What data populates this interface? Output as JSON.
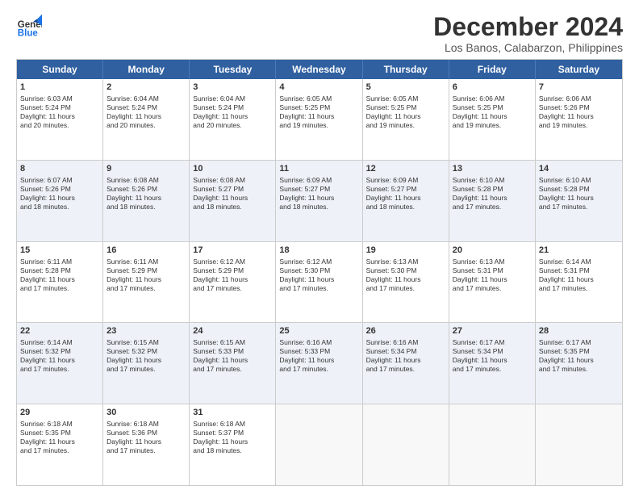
{
  "logo": {
    "text_general": "General",
    "text_blue": "Blue"
  },
  "title": "December 2024",
  "subtitle": "Los Banos, Calabarzon, Philippines",
  "days_of_week": [
    "Sunday",
    "Monday",
    "Tuesday",
    "Wednesday",
    "Thursday",
    "Friday",
    "Saturday"
  ],
  "weeks": [
    [
      {
        "day": "1",
        "text": "Sunrise: 6:03 AM\nSunset: 5:24 PM\nDaylight: 11 hours\nand 20 minutes."
      },
      {
        "day": "2",
        "text": "Sunrise: 6:04 AM\nSunset: 5:24 PM\nDaylight: 11 hours\nand 20 minutes."
      },
      {
        "day": "3",
        "text": "Sunrise: 6:04 AM\nSunset: 5:24 PM\nDaylight: 11 hours\nand 20 minutes."
      },
      {
        "day": "4",
        "text": "Sunrise: 6:05 AM\nSunset: 5:25 PM\nDaylight: 11 hours\nand 19 minutes."
      },
      {
        "day": "5",
        "text": "Sunrise: 6:05 AM\nSunset: 5:25 PM\nDaylight: 11 hours\nand 19 minutes."
      },
      {
        "day": "6",
        "text": "Sunrise: 6:06 AM\nSunset: 5:25 PM\nDaylight: 11 hours\nand 19 minutes."
      },
      {
        "day": "7",
        "text": "Sunrise: 6:06 AM\nSunset: 5:26 PM\nDaylight: 11 hours\nand 19 minutes."
      }
    ],
    [
      {
        "day": "8",
        "text": "Sunrise: 6:07 AM\nSunset: 5:26 PM\nDaylight: 11 hours\nand 18 minutes."
      },
      {
        "day": "9",
        "text": "Sunrise: 6:08 AM\nSunset: 5:26 PM\nDaylight: 11 hours\nand 18 minutes."
      },
      {
        "day": "10",
        "text": "Sunrise: 6:08 AM\nSunset: 5:27 PM\nDaylight: 11 hours\nand 18 minutes."
      },
      {
        "day": "11",
        "text": "Sunrise: 6:09 AM\nSunset: 5:27 PM\nDaylight: 11 hours\nand 18 minutes."
      },
      {
        "day": "12",
        "text": "Sunrise: 6:09 AM\nSunset: 5:27 PM\nDaylight: 11 hours\nand 18 minutes."
      },
      {
        "day": "13",
        "text": "Sunrise: 6:10 AM\nSunset: 5:28 PM\nDaylight: 11 hours\nand 17 minutes."
      },
      {
        "day": "14",
        "text": "Sunrise: 6:10 AM\nSunset: 5:28 PM\nDaylight: 11 hours\nand 17 minutes."
      }
    ],
    [
      {
        "day": "15",
        "text": "Sunrise: 6:11 AM\nSunset: 5:28 PM\nDaylight: 11 hours\nand 17 minutes."
      },
      {
        "day": "16",
        "text": "Sunrise: 6:11 AM\nSunset: 5:29 PM\nDaylight: 11 hours\nand 17 minutes."
      },
      {
        "day": "17",
        "text": "Sunrise: 6:12 AM\nSunset: 5:29 PM\nDaylight: 11 hours\nand 17 minutes."
      },
      {
        "day": "18",
        "text": "Sunrise: 6:12 AM\nSunset: 5:30 PM\nDaylight: 11 hours\nand 17 minutes."
      },
      {
        "day": "19",
        "text": "Sunrise: 6:13 AM\nSunset: 5:30 PM\nDaylight: 11 hours\nand 17 minutes."
      },
      {
        "day": "20",
        "text": "Sunrise: 6:13 AM\nSunset: 5:31 PM\nDaylight: 11 hours\nand 17 minutes."
      },
      {
        "day": "21",
        "text": "Sunrise: 6:14 AM\nSunset: 5:31 PM\nDaylight: 11 hours\nand 17 minutes."
      }
    ],
    [
      {
        "day": "22",
        "text": "Sunrise: 6:14 AM\nSunset: 5:32 PM\nDaylight: 11 hours\nand 17 minutes."
      },
      {
        "day": "23",
        "text": "Sunrise: 6:15 AM\nSunset: 5:32 PM\nDaylight: 11 hours\nand 17 minutes."
      },
      {
        "day": "24",
        "text": "Sunrise: 6:15 AM\nSunset: 5:33 PM\nDaylight: 11 hours\nand 17 minutes."
      },
      {
        "day": "25",
        "text": "Sunrise: 6:16 AM\nSunset: 5:33 PM\nDaylight: 11 hours\nand 17 minutes."
      },
      {
        "day": "26",
        "text": "Sunrise: 6:16 AM\nSunset: 5:34 PM\nDaylight: 11 hours\nand 17 minutes."
      },
      {
        "day": "27",
        "text": "Sunrise: 6:17 AM\nSunset: 5:34 PM\nDaylight: 11 hours\nand 17 minutes."
      },
      {
        "day": "28",
        "text": "Sunrise: 6:17 AM\nSunset: 5:35 PM\nDaylight: 11 hours\nand 17 minutes."
      }
    ],
    [
      {
        "day": "29",
        "text": "Sunrise: 6:18 AM\nSunset: 5:35 PM\nDaylight: 11 hours\nand 17 minutes."
      },
      {
        "day": "30",
        "text": "Sunrise: 6:18 AM\nSunset: 5:36 PM\nDaylight: 11 hours\nand 17 minutes."
      },
      {
        "day": "31",
        "text": "Sunrise: 6:18 AM\nSunset: 5:37 PM\nDaylight: 11 hours\nand 18 minutes."
      },
      {
        "day": "",
        "text": ""
      },
      {
        "day": "",
        "text": ""
      },
      {
        "day": "",
        "text": ""
      },
      {
        "day": "",
        "text": ""
      }
    ]
  ]
}
